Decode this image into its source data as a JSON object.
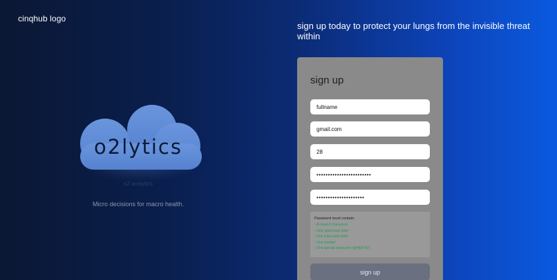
{
  "header": {
    "logo_text": "cinqhub logo",
    "hero_title": "sign up today to protect your lungs from the invisible threat within"
  },
  "brand": {
    "cloud_text": "o2lytics",
    "faint_label": "o2 analytics",
    "tagline": "Micro decisions for macro health."
  },
  "form": {
    "title": "sign up",
    "fields": {
      "fullname": {
        "value": "fullname"
      },
      "email": {
        "value": "gmail.com"
      },
      "age": {
        "value": "28"
      },
      "password": {
        "value": "••••••••••••••••••••••••"
      },
      "confirm_password": {
        "value": "•••••••••••••••••••••"
      }
    },
    "password_rules": {
      "title": "Password must contain:",
      "items": [
        "- At least 8 characters",
        "- One uppercase letter",
        "- One lowercase letter",
        "- One number",
        "- One special character (!@#$%^&*)"
      ],
      "color": "#1a9e52"
    },
    "submit_label": "sign up"
  },
  "colors": {
    "bg_left": "#0b1733",
    "bg_right": "#0a5ae0",
    "card": "#8a8a8a",
    "cloud": "#5b88d4",
    "submit": "#6b7080"
  }
}
